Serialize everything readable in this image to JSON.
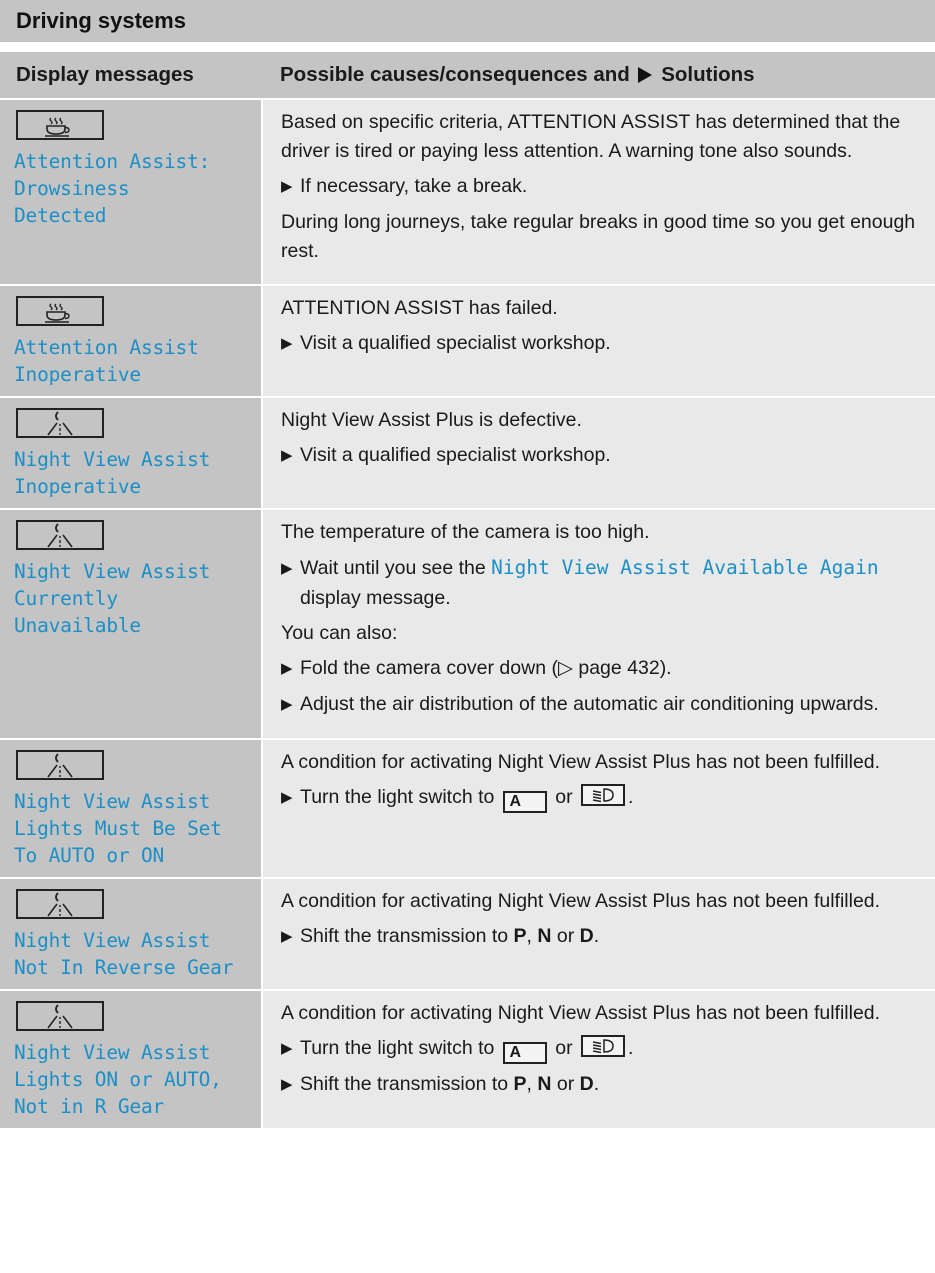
{
  "section": {
    "title": "Driving systems"
  },
  "table": {
    "headers": {
      "col1": "Display messages",
      "col2_before": "Possible causes/consequences and",
      "col2_after": "Solutions"
    },
    "rows": [
      {
        "icon": "coffee-cup-icon",
        "message": "Attention Assist:\nDrowsiness\nDetected",
        "para1": "Based on specific criteria, ATTENTION ASSIST has determined that the driver is tired or paying less attention. A warning tone also sounds.",
        "step1": "If necessary, take a break.",
        "para2": "During long journeys, take regular breaks in good time so you get enough rest."
      },
      {
        "icon": "coffee-cup-icon",
        "message": "Attention Assist\nInoperative",
        "para1": "ATTENTION ASSIST has failed.",
        "step1": "Visit a qualified specialist workshop."
      },
      {
        "icon": "night-view-icon",
        "message": "Night View Assist\nInoperative",
        "para1": "Night View Assist Plus is defective.",
        "step1": "Visit a qualified specialist workshop."
      },
      {
        "icon": "night-view-icon",
        "message": "Night View Assist\nCurrently\nUnavailable",
        "para1": "The temperature of the camera is too high.",
        "step1_before": "Wait until you see the",
        "step1_msg": "Night View Assist Available Again",
        "step1_after": "display message.",
        "para2": "You can also:",
        "step2": "Fold the camera cover down (▷ page 432).",
        "step3": "Adjust the air distribution of the automatic air conditioning upwards."
      },
      {
        "icon": "night-view-icon",
        "message": "Night View Assist\nLights Must Be Set\nTo AUTO or ON",
        "para1": "A condition for activating Night View Assist Plus has not been fulfilled.",
        "step1_before": "Turn the light switch to",
        "key_a": "A",
        "step1_or": "or",
        "step1_end": "."
      },
      {
        "icon": "night-view-icon",
        "message": "Night View Assist\nNot In Reverse Gear",
        "para1": "A condition for activating Night View Assist Plus has not been fulfilled.",
        "step1_before": "Shift the transmission to",
        "p": "P",
        "sep": ",",
        "n": "N",
        "or": "or",
        "d": "D",
        "end": "."
      },
      {
        "icon": "night-view-icon",
        "message": "Night View Assist\nLights ON or AUTO,\nNot in R Gear",
        "para1": "A condition for activating Night View Assist Plus has not been fulfilled.",
        "step1_before": "Turn the light switch to",
        "key_a": "A",
        "step1_or": "or",
        "step1_end": ".",
        "step2_before": "Shift the transmission to",
        "p": "P",
        "sep": ",",
        "n": "N",
        "or": "or",
        "d": "D",
        "end": "."
      }
    ]
  }
}
